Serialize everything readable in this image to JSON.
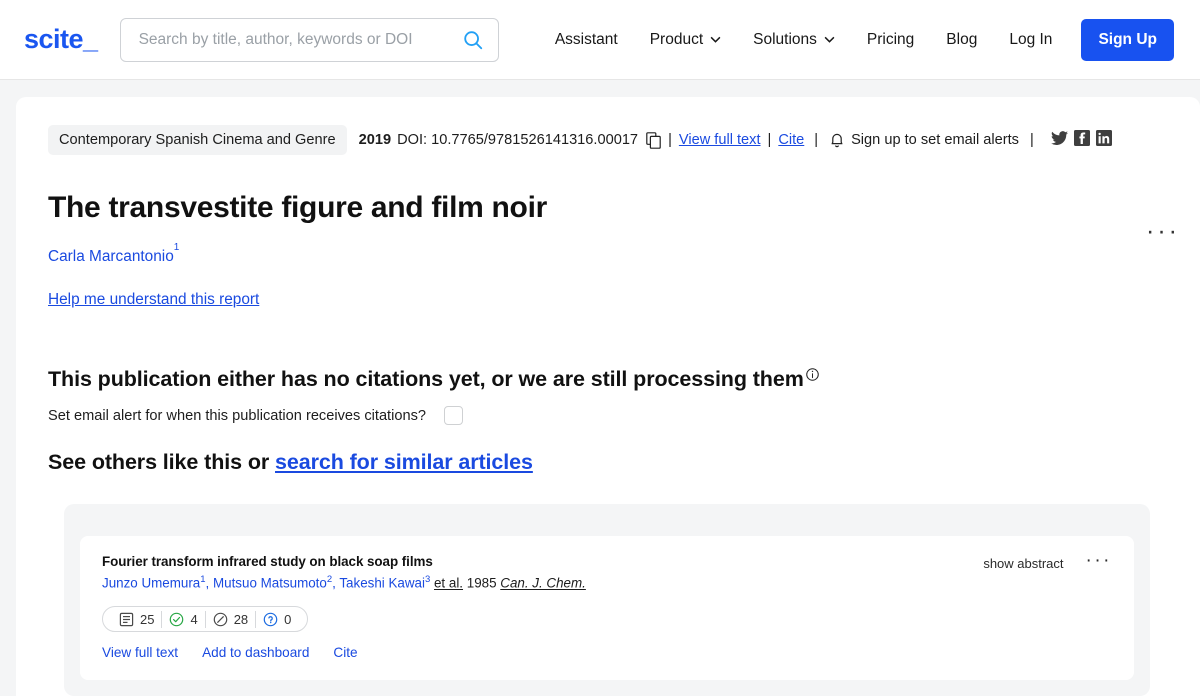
{
  "navbar": {
    "logo": "scite_",
    "search": {
      "placeholder": "Search by title, author, keywords or DOI",
      "value": ""
    },
    "search_icon": "search-icon",
    "links": [
      {
        "label": "Assistant",
        "has_chevron": false
      },
      {
        "label": "Product",
        "has_chevron": true
      },
      {
        "label": "Solutions",
        "has_chevron": true
      },
      {
        "label": "Pricing",
        "has_chevron": false
      },
      {
        "label": "Blog",
        "has_chevron": false
      },
      {
        "label": "Log In",
        "has_chevron": false
      }
    ],
    "signup_label": "Sign Up",
    "signup_color": "#1852f0"
  },
  "publication": {
    "journal": "Contemporary Spanish Cinema and Genre",
    "year": "2019",
    "doi_label": "DOI:",
    "doi": "10.7765/9781526141316.00017",
    "copy_icon": "copy-icon",
    "sep": "|",
    "view_full_text": "View full text",
    "cite": "Cite",
    "bell_icon": "bell-icon",
    "email_alerts": "Sign up to set email alerts",
    "social": [
      "twitter-icon",
      "facebook-icon",
      "linkedin-icon"
    ],
    "kebab": "···",
    "title": "The transvestite figure and film noir",
    "author": "Carla Marcantonio",
    "author_sup": "1",
    "help_link": "Help me understand this report"
  },
  "citations": {
    "heading": "This publication either has no citations yet, or we are still processing them",
    "info_icon": "info-icon",
    "alert_label": "Set email alert for when this publication receives citations?",
    "alert_checked": false
  },
  "similar": {
    "heading_prefix": "See others like this or ",
    "heading_link": "search for similar articles",
    "results": [
      {
        "title": "Fourier transform infrared study on black soap films",
        "authors": [
          {
            "name": "Junzo Umemura",
            "sup": "1"
          },
          {
            "name": "Mutsuo Matsumoto",
            "sup": "2"
          },
          {
            "name": "Takeshi Kawai",
            "sup": "3"
          }
        ],
        "etal": "et al.",
        "year": "1985",
        "journal": "Can. J. Chem.",
        "badges": [
          {
            "icon": "publication-icon",
            "value": "25",
            "color": "#4a4a4a"
          },
          {
            "icon": "supporting-check-icon",
            "value": "4",
            "color": "#28a745"
          },
          {
            "icon": "mentioning-slash-icon",
            "value": "28",
            "color": "#4a4a4a"
          },
          {
            "icon": "contrasting-question-icon",
            "value": "0",
            "color": "#1a6ae0"
          }
        ],
        "links": [
          "View full text",
          "Add to dashboard",
          "Cite"
        ],
        "show_abstract": "show abstract",
        "kebab": "···"
      }
    ]
  }
}
